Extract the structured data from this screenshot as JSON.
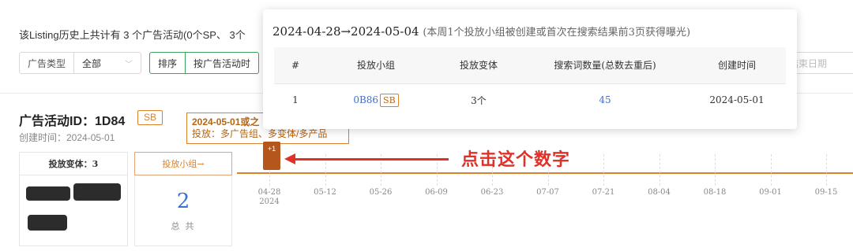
{
  "summary": "该Listing历史上共计有 3 个广告活动(0个SP、 3个",
  "filters": {
    "ad_type_label": "广告类型",
    "ad_type_value": "全部",
    "sort_label": "排序",
    "sort_value": "按广告活动时",
    "end_date_placeholder": "结束日期"
  },
  "campaign": {
    "title": "广告活动ID：1D84",
    "badge": "SB",
    "created": "创建时间：2024-05-01",
    "note_line1": "2024-05-01或之",
    "note_line2": "投放：多广告组、多变体/多产品",
    "variant_header": "投放变体：3",
    "group_header": "投放小组→",
    "group_count": "2",
    "group_total_label": "总 共"
  },
  "timeline": {
    "marker": "+1",
    "dates": [
      "04-28",
      "05-12",
      "05-26",
      "06-09",
      "06-23",
      "07-07",
      "07-21",
      "08-04",
      "08-18",
      "09-01",
      "09-15"
    ],
    "first_year": "2024",
    "accent_color": "#d9822b"
  },
  "annotation": {
    "text": "点击这个数字",
    "color": "#e03028"
  },
  "popup": {
    "range": "2024-04-28→2024-05-04",
    "subtitle": "(本周1个投放小组被创建或首次在搜索结果前3页获得曝光)",
    "columns": [
      "#",
      "投放小组",
      "投放变体",
      "搜索词数量(总数去重后)",
      "创建时间"
    ],
    "rows": [
      {
        "idx": "1",
        "group": "0B86",
        "group_tag": "SB",
        "variants": "3个",
        "keywords": "45",
        "created": "2024-05-01"
      }
    ]
  }
}
